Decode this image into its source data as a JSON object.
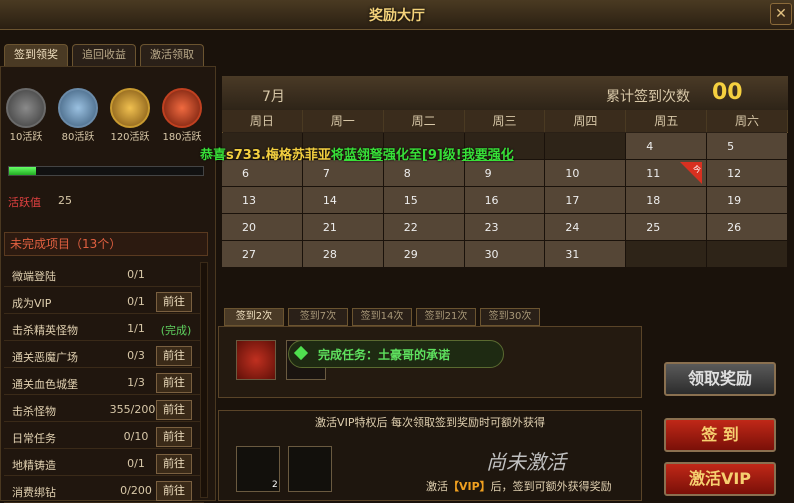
{
  "window": {
    "title": "奖励大厅",
    "close": "✕"
  },
  "tabs": [
    {
      "label": "签到领奖",
      "active": true
    },
    {
      "label": "追回收益",
      "active": false
    },
    {
      "label": "激活领取",
      "active": false
    }
  ],
  "chests": [
    {
      "label": "10活跃",
      "color": "#6a6a6a"
    },
    {
      "label": "80活跃",
      "color": "#6a8aa8"
    },
    {
      "label": "120活跃",
      "color": "#c89a30"
    },
    {
      "label": "180活跃",
      "color": "#c04020"
    }
  ],
  "activity": {
    "label": "活跃值",
    "value": "25",
    "progress": 0.14
  },
  "pending": {
    "title": "未完成项目（13个）",
    "tasks": [
      {
        "name": "微端登陆",
        "progress": "0/1",
        "action": ""
      },
      {
        "name": "成为VIP",
        "progress": "0/1",
        "action": "前往"
      },
      {
        "name": "击杀精英怪物",
        "progress": "1/1",
        "action": "(完成)"
      },
      {
        "name": "通关恶魔广场",
        "progress": "0/3",
        "action": "前往"
      },
      {
        "name": "通关血色城堡",
        "progress": "1/3",
        "action": "前往"
      },
      {
        "name": "击杀怪物",
        "progress": "355/2000",
        "action": "前往"
      },
      {
        "name": "日常任务",
        "progress": "0/10",
        "action": "前往"
      },
      {
        "name": "地精铸造",
        "progress": "0/1",
        "action": "前往"
      },
      {
        "name": "消费绑钻",
        "progress": "0/200",
        "action": "前往"
      }
    ]
  },
  "calendar": {
    "month": "7月",
    "sign_count_label": "累计签到次数",
    "sign_count": "00",
    "weekdays": [
      "周日",
      "周一",
      "周二",
      "周三",
      "周四",
      "周五",
      "周六"
    ],
    "rows": [
      [
        "",
        "",
        "",
        "",
        "",
        "4",
        "5"
      ],
      [
        "6",
        "7",
        "8",
        "9",
        "10",
        "11",
        "12"
      ],
      [
        "13",
        "14",
        "15",
        "16",
        "17",
        "18",
        "19"
      ],
      [
        "20",
        "21",
        "22",
        "23",
        "24",
        "25",
        "26"
      ],
      [
        "27",
        "28",
        "29",
        "30",
        "31",
        "",
        ""
      ]
    ],
    "today_badge": "今"
  },
  "announcement": {
    "prefix": "恭喜",
    "player": "s733.梅格苏菲亚",
    "mid": "将",
    "item": "蓝翎弩",
    "suffix": "强化至[9]级!",
    "link": "我要强化"
  },
  "sign_tabs": [
    "签到2次",
    "签到7次",
    "签到14次",
    "签到21次",
    "签到30次"
  ],
  "task_banner": "完成任务：土豪哥的承诺",
  "vip": {
    "note": "激活VIP特权后 每次领取签到奖励时可额外获得",
    "slot_count": "2",
    "status": "尚未激活",
    "hint_prefix": "激活",
    "hint_vip": "【VIP】",
    "hint_suffix": "后，签到可额外获得奖励"
  },
  "buttons": {
    "claim": "领取奖励",
    "sign": "签 到",
    "activate_vip": "激活VIP"
  }
}
